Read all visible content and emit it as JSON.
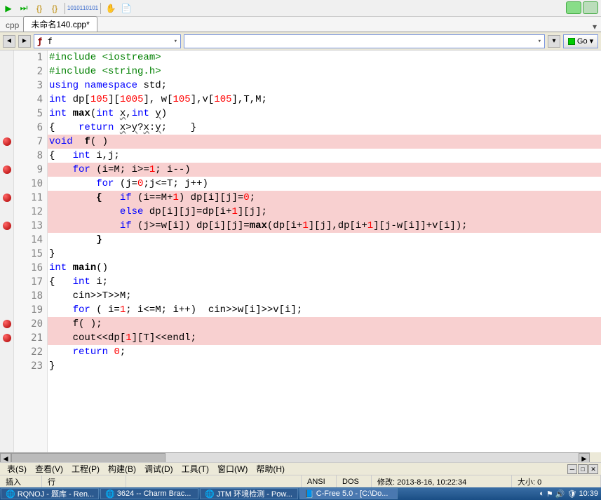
{
  "toolbar": {
    "icons": [
      "play",
      "step",
      "brace",
      "brace2",
      "binary",
      "binary2",
      "hand",
      "note"
    ]
  },
  "tab": {
    "label": "未命名140.cpp*",
    "prefix": "cpp"
  },
  "nav": {
    "func_symbol": "ƒ",
    "func_text": "f",
    "go_label": "Go"
  },
  "code": {
    "lines": [
      {
        "n": 1,
        "bp": false,
        "hl": false,
        "html": "<span class='pre'>#include &lt;iostream&gt;</span>"
      },
      {
        "n": 2,
        "bp": false,
        "hl": false,
        "html": "<span class='pre'>#include &lt;string.h&gt;</span>"
      },
      {
        "n": 3,
        "bp": false,
        "hl": false,
        "html": "<span class='kw'>using</span> <span class='kw'>namespace</span> std;"
      },
      {
        "n": 4,
        "bp": false,
        "hl": false,
        "html": "<span class='ty'>int</span> dp[<span class='num'>105</span>][<span class='num'>1005</span>], w[<span class='num'>105</span>],v[<span class='num'>105</span>],T,M;"
      },
      {
        "n": 5,
        "bp": false,
        "hl": false,
        "html": "<span class='ty'>int</span> <span class='fn'>max</span>(<span class='ty'>int</span> <span class='underline'>x</span>,<span class='ty'>int</span> <span class='underline'>y</span>)"
      },
      {
        "n": 6,
        "bp": false,
        "hl": false,
        "html": "{    <span class='kw'>return</span> <span class='underline'>x</span>&gt;<span class='underline'>y</span>?<span class='underline'>x</span>:<span class='underline'>y</span>;    }"
      },
      {
        "n": 7,
        "bp": true,
        "hl": true,
        "html": "<span class='ty'>void</span>  <span class='fn'>f</span>( )"
      },
      {
        "n": 8,
        "bp": false,
        "hl": false,
        "html": "{   <span class='ty'>int</span> i,j;"
      },
      {
        "n": 9,
        "bp": true,
        "hl": true,
        "html": "    <span class='kw'>for</span> (i=M; i&gt;=<span class='num'>1</span>; i--)"
      },
      {
        "n": 10,
        "bp": false,
        "hl": false,
        "html": "        <span class='kw'>for</span> (j=<span class='num'>0</span>;j&lt;=T; j++)"
      },
      {
        "n": 11,
        "bp": true,
        "hl": true,
        "html": "        <b>{</b>   <span class='kw'>if</span> (i==M+<span class='num'>1</span>) dp[i][j]=<span class='num'>0</span>;"
      },
      {
        "n": 12,
        "bp": false,
        "hl": true,
        "html": "            <span class='kw'>else</span> dp[i][j]=dp[i+<span class='num'>1</span>][j];"
      },
      {
        "n": 13,
        "bp": true,
        "hl": true,
        "html": "            <span class='kw'>if</span> (j&gt;=w[i]) dp[i][j]=<span class='fn'>max</span>(dp[i+<span class='num'>1</span>][j],dp[i+<span class='num'>1</span>][j-w[i]]+v[i]);"
      },
      {
        "n": 14,
        "bp": false,
        "hl": false,
        "html": "        <b>}</b>"
      },
      {
        "n": 15,
        "bp": false,
        "hl": false,
        "html": "}"
      },
      {
        "n": 16,
        "bp": false,
        "hl": false,
        "html": "<span class='ty'>int</span> <span class='fn'>main</span>()"
      },
      {
        "n": 17,
        "bp": false,
        "hl": false,
        "html": "{   <span class='ty'>int</span> i;"
      },
      {
        "n": 18,
        "bp": false,
        "hl": false,
        "html": "    cin&gt;&gt;T&gt;&gt;M;"
      },
      {
        "n": 19,
        "bp": false,
        "hl": false,
        "html": "    <span class='kw'>for</span> ( i=<span class='num'>1</span>; i&lt;=M; i++)  cin&gt;&gt;w[i]&gt;&gt;v[i];"
      },
      {
        "n": 20,
        "bp": true,
        "hl": true,
        "html": "    f( );"
      },
      {
        "n": 21,
        "bp": true,
        "hl": true,
        "html": "    cout&lt;&lt;dp[<span class='num'>1</span>][T]&lt;&lt;endl;"
      },
      {
        "n": 22,
        "bp": false,
        "hl": false,
        "html": "    <span class='kw'>return</span> <span class='num'>0</span>;"
      },
      {
        "n": 23,
        "bp": false,
        "hl": false,
        "html": "}"
      }
    ]
  },
  "menu": {
    "items": [
      "表(S)",
      "查看(V)",
      "工程(P)",
      "构建(B)",
      "调试(D)",
      "工具(T)",
      "窗口(W)",
      "帮助(H)"
    ]
  },
  "status": {
    "insert": "插入",
    "line": "行",
    "col": "",
    "ansi": "ANSI",
    "dos": "DOS",
    "modified": "修改: 2013-8-16, 10:22:34",
    "size": "大小: 0"
  },
  "taskbar": {
    "items": [
      "RQNOJ - 题库 - Ren...",
      "3624 -- Charm Brac...",
      "JTM 环境检测 - Pow...",
      "C-Free 5.0 - [C:\\Do..."
    ],
    "time": "10:39"
  }
}
